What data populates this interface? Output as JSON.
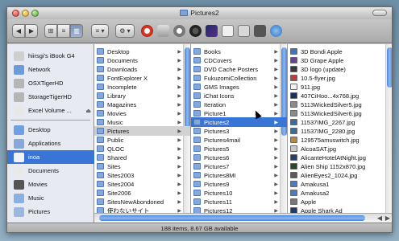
{
  "window": {
    "title": "Pictures2"
  },
  "toolbar": {
    "back_label": "◀",
    "forward_label": "▶",
    "view_icon_label": "⊞",
    "view_list_label": "≡",
    "view_column_label": "▥",
    "action_label": "⚙ ▾",
    "arrange_label": "≡ ▾"
  },
  "sidebar": {
    "devices": [
      {
        "label": "hiirsgi's iBook G4",
        "icon": "laptop-icon",
        "color": "#cfcfcf"
      },
      {
        "label": "Network",
        "icon": "globe-icon",
        "color": "#6b9bd8"
      },
      {
        "label": "OSXTigerHD",
        "icon": "hard-drive-icon",
        "color": "#b5b5b5"
      },
      {
        "label": "StorageTigerHD",
        "icon": "hard-drive-icon",
        "color": "#b5b5b5"
      },
      {
        "label": "Excel Volume ...",
        "icon": "disk-icon",
        "color": "#e8e8e8"
      }
    ],
    "places": [
      {
        "label": "Desktop",
        "icon": "desktop-icon",
        "color": "#6fa0e0"
      },
      {
        "label": "Applications",
        "icon": "applications-icon",
        "color": "#87a8d8"
      },
      {
        "label": "inoa",
        "icon": "home-icon",
        "color": "#f3f3f3"
      },
      {
        "label": "Documents",
        "icon": "documents-icon",
        "color": "#e9e9e9"
      },
      {
        "label": "Movies",
        "icon": "movies-icon",
        "color": "#555"
      },
      {
        "label": "Music",
        "icon": "music-icon",
        "color": "#8ab0e0"
      },
      {
        "label": "Pictures",
        "icon": "pictures-icon",
        "color": "#9bb8dc"
      }
    ]
  },
  "column1": [
    "Desktop",
    "Documents",
    "Downloads",
    "FontExplorer X",
    "Incomplete",
    "Library",
    "Magazines",
    "Movies",
    "Music",
    "Pictures",
    "Public",
    "QLOC",
    "Shared",
    "Sites",
    "Sites2003",
    "Sites2004",
    "Site2006",
    "SitesNewAbondoned",
    "使わないサイト"
  ],
  "column2": [
    "Books",
    "CDCovers",
    "DVD Cache Posters",
    "FukuzomiCollection",
    "GMS Images",
    "iChat Icons",
    "Iteration",
    "Picture1",
    "Pictures2",
    "Pictures3",
    "Pictures4mail",
    "Pictures5",
    "Pictures6",
    "Pictures7",
    "Pictures8MI",
    "Pictures9",
    "Pictures10",
    "Pictures11",
    "Pictures12"
  ],
  "column3": [
    {
      "label": "3D Bondi Apple",
      "color": "#3d74c6"
    },
    {
      "label": "3D Grape Apple",
      "color": "#6b3f9c"
    },
    {
      "label": "3D logo (update)",
      "color": "#3a3a3a"
    },
    {
      "label": "10.5-flyer.jpg",
      "color": "#c23a3a"
    },
    {
      "label": "911.jpg",
      "color": "#f2f2f2"
    },
    {
      "label": "407CiHoo...4x768.jpg",
      "color": "#1b2f5c"
    },
    {
      "label": "5113WickedSilver5.jpg",
      "color": "#8b8b8b"
    },
    {
      "label": "5113WickedSilver6.jpg",
      "color": "#8b8b8b"
    },
    {
      "label": "11537IMG_2267.jpg",
      "color": "#3e6b9e"
    },
    {
      "label": "11537IMG_2280.jpg",
      "color": "#3e6b9e"
    },
    {
      "label": "129575amuswitch.jpg",
      "color": "#b88b3a"
    },
    {
      "label": "AlcoaSAT.jpg",
      "color": "#c8c8c8"
    },
    {
      "label": "AlicanteHotelAtNight.jpg",
      "color": "#2a3c6a"
    },
    {
      "label": "Alien Ship 1152x870.jpg",
      "color": "#264a26"
    },
    {
      "label": "AlienEyes2_1024.jpg",
      "color": "#5c5c5c"
    },
    {
      "label": "Amakusa1",
      "color": "#4a7cbf"
    },
    {
      "label": "Amakusa2",
      "color": "#4a7cbf"
    },
    {
      "label": "Apple",
      "color": "#777"
    },
    {
      "label": "Apple Shark Ad",
      "color": "#1c3c6c"
    }
  ],
  "status": {
    "text": "188 items, 8.67 GB available"
  }
}
